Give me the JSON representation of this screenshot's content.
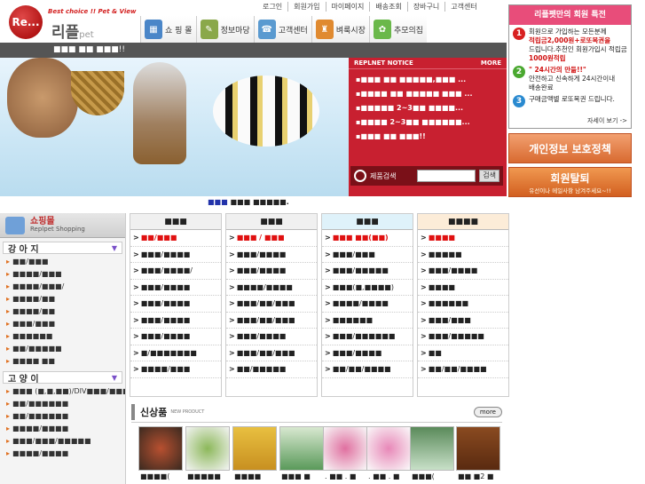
{
  "header": {
    "logo_text": "Re...",
    "tagline": "Best choice !! Pet & View",
    "brand_main": "리플",
    "brand_sub": "pet",
    "top_links": [
      "로그인",
      "회원가입",
      "마이페이지",
      "배송조회",
      "장바구니",
      "고객센터"
    ],
    "main_nav": [
      "쇼 핑 몰",
      "정보마당",
      "고객센터",
      "벼룩시장",
      "추모의집"
    ],
    "dark_bar_text": "■■■ ■■ ■■■!!"
  },
  "notice": {
    "header": "REPLNET NOTICE",
    "more": "MORE",
    "items": [
      "■■■ ■■ ■■■■■,■■■ ...",
      "■■■■ ■■ ■■■■■ ■■■ ...",
      "■■■■■ 2~3■■ ■■■■...",
      "■■■■ 2~3■■ ■■■■■■...",
      "■■■ ■■ ■■■!!"
    ]
  },
  "search": {
    "label": "제품검색",
    "button": "검색"
  },
  "hero_caption": {
    "highlight": "■■■",
    "rest": "■■■ ■■■■■."
  },
  "sidebar": {
    "title": "쇼핑몰",
    "subtitle": "Replpet Shopping",
    "sections": [
      {
        "title": "강 아 지",
        "items": [
          "■■/■■■",
          "■■■■/■■■",
          "■■■■/■■■/",
          "■■■■/■■",
          "■■■■/■■",
          "■■■/■■■",
          "■■■■■■",
          "■■/■■■■■",
          "■■■■ ■■"
        ]
      },
      {
        "title": "고 양 이",
        "items": [
          "■■■ (■,■,■■)/DIV■■■/■■■■",
          "■■/■■■■■■",
          "■■/■■■■■■",
          "■■■■/■■■■",
          "■■■/■■■/■■■■■",
          "■■■■/■■■■"
        ]
      }
    ]
  },
  "columns": [
    {
      "title": "■■■",
      "items": [
        "■■/■■■",
        "■■■/■■■■",
        "■■■/■■■■/",
        "■■■/■■■■",
        "■■■/■■■■",
        "■■■/■■■■",
        "■■■/■■■■",
        "■/■■■■■■■",
        "■■■■/■■■"
      ]
    },
    {
      "title": "■■■",
      "items": [
        "■■■ / ■■■",
        "■■■/■■■■",
        "■■■/■■■■",
        "■■■■/■■■■",
        "■■■/■■/■■■",
        "■■■/■■/■■■",
        "■■■/■■■■",
        "■■■/■■/■■■",
        "■■/■■■■■"
      ]
    },
    {
      "title": "■■■",
      "items": [
        "■■■ ■■(■■)",
        "■■■/■■■",
        "■■■/■■■■■",
        "■■■(■,■■■■)",
        "■■■■/■■■■",
        "■■■■■■",
        "■■■/■■■■■■",
        "■■■/■■■■",
        "■■/■■/■■■■"
      ]
    },
    {
      "title": "■■■■",
      "items": [
        "■■■■",
        "■■■■■",
        "■■■/■■■■",
        "■■■■",
        "■■■■■■",
        "■■■/■■■",
        "■■■/■■■■■",
        "■■",
        "■■/■■/■■■■"
      ]
    }
  ],
  "new_products": {
    "title": "신상품",
    "subtitle": "NEW PRODUCT",
    "more": "more",
    "captions": [
      "■■■■(",
      "■■■■■",
      "■■■■",
      "■■■ ■",
      ". ■■ . ■",
      ". ■■ . ■",
      "■■■(",
      "■■ ■2 ■"
    ]
  },
  "right_promo": {
    "title": "리플펫만의 회원 특전",
    "rows": [
      {
        "num": "1",
        "lines": [
          "회원으로 가입하는 모든분께",
          "적립금2,000원+로또복권을",
          "드립니다.추천인 회원가입시 적립금",
          "1000원적립"
        ]
      },
      {
        "num": "2",
        "lines": [
          "\" 24시간의 만듦!!\"",
          "안전하고 신속하게 24시간이내",
          "배송완료"
        ]
      },
      {
        "num": "3",
        "lines": [
          "구매금액별 로또복권 드립니다."
        ]
      }
    ],
    "more": "자세이 보기 ->"
  },
  "privacy_banner": "개인정보 보호정책",
  "withdraw_banner": {
    "title": "회원탈퇴",
    "subtitle": "유선이나 메일사항 남겨주세요~!!"
  },
  "colors": {
    "notice_red": "#c82030",
    "promo_pink": "#e84d7a",
    "banner_orange": "#d86a30",
    "link_red": "#e01010"
  }
}
